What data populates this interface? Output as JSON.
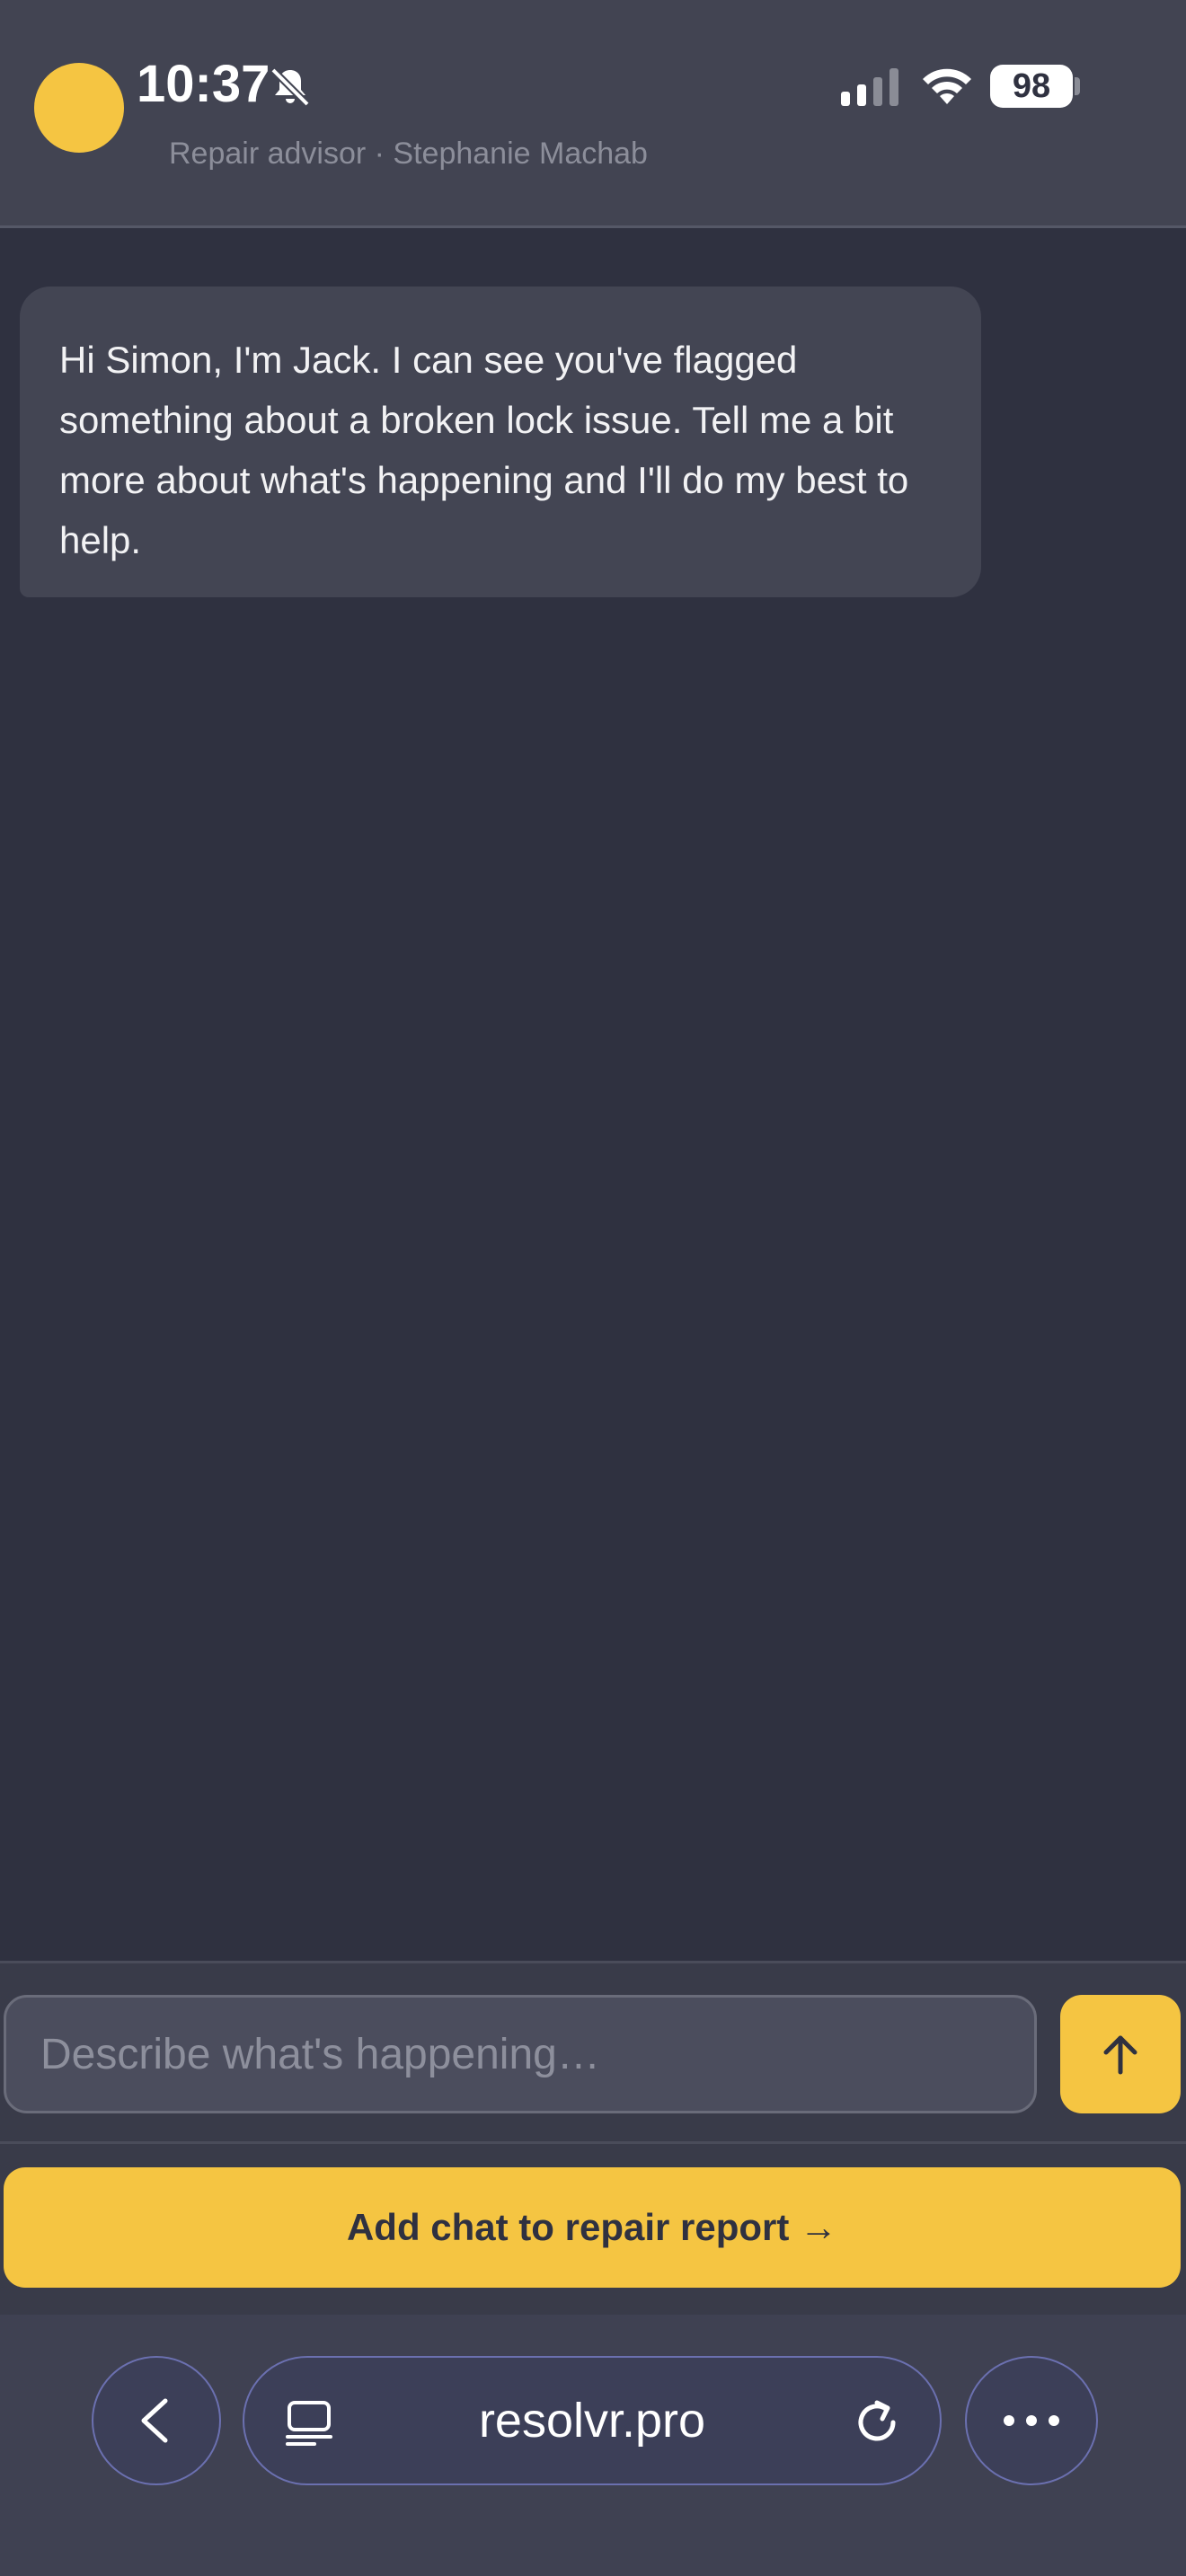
{
  "status_bar": {
    "time": "10:37",
    "battery": "98",
    "icons": [
      "bell-slash-icon",
      "cellular-signal-icon",
      "wifi-icon",
      "battery-icon"
    ]
  },
  "header": {
    "subtitle": "Repair advisor · Stephanie Machab"
  },
  "chat": {
    "messages": [
      {
        "sender": "assistant",
        "text": "Hi Simon, I'm Jack. I can see you've flagged something about a broken lock issue. Tell me a bit more about what's happening and I'll do my best to help."
      }
    ]
  },
  "composer": {
    "placeholder": "Describe what's happening…",
    "send_icon": "arrow-up-icon"
  },
  "actions": {
    "report_label": "Add chat to repair report →"
  },
  "browser": {
    "url": "resolvr.pro",
    "icons": [
      "chevron-left-icon",
      "tabs-icon",
      "reload-icon",
      "more-icon"
    ]
  },
  "colors": {
    "accent": "#f5c542",
    "background": "#2f3140",
    "bubble": "#434553"
  }
}
